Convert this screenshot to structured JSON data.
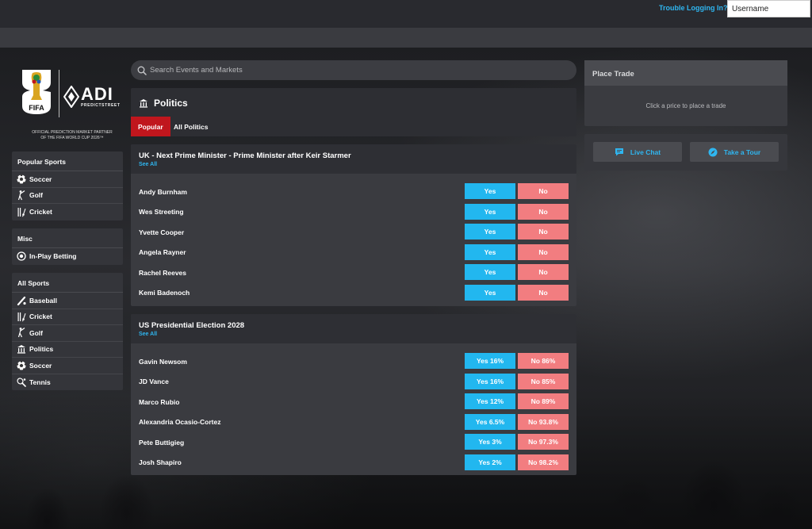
{
  "colors": {
    "accent": "#2fb6f0",
    "yes": "#22b7ef",
    "no": "#f27d80",
    "tab_active": "#c0161d"
  },
  "header": {
    "trouble_link": "Trouble Logging In?",
    "username_value": "Username"
  },
  "logo": {
    "fifa_text": "FIFA",
    "adi_text": "ADI",
    "adi_sub": "PREDICTSTREET",
    "partner_line1": "OFFICIAL PREDICTION MARKET PARTNER",
    "partner_line2": "OF THE FIFA WORLD CUP 2026™"
  },
  "sidebar": {
    "popular": {
      "title": "Popular Sports",
      "items": [
        {
          "label": "Soccer",
          "icon": "soccer-ball-icon"
        },
        {
          "label": "Golf",
          "icon": "golfer-icon"
        },
        {
          "label": "Cricket",
          "icon": "cricket-icon"
        }
      ]
    },
    "misc": {
      "title": "Misc",
      "items": [
        {
          "label": "In-Play Betting",
          "icon": "inplay-icon"
        }
      ]
    },
    "all": {
      "title": "All Sports",
      "items": [
        {
          "label": "Baseball",
          "icon": "baseball-icon"
        },
        {
          "label": "Cricket",
          "icon": "cricket-icon"
        },
        {
          "label": "Golf",
          "icon": "golfer-icon"
        },
        {
          "label": "Politics",
          "icon": "capitol-icon"
        },
        {
          "label": "Soccer",
          "icon": "soccer-ball-icon"
        },
        {
          "label": "Tennis",
          "icon": "tennis-icon"
        }
      ]
    }
  },
  "search": {
    "placeholder": "Search Events and Markets"
  },
  "politics": {
    "title": "Politics",
    "tabs": [
      {
        "label": "Popular"
      },
      {
        "label": "All Politics"
      }
    ]
  },
  "markets": [
    {
      "title": "UK - Next Prime Minister - Prime Minister after Keir Starmer",
      "see_all": "See All",
      "rows": [
        {
          "name": "Andy Burnham",
          "yes": "Yes",
          "no": "No"
        },
        {
          "name": "Wes Streeting",
          "yes": "Yes",
          "no": "No"
        },
        {
          "name": "Yvette Cooper",
          "yes": "Yes",
          "no": "No"
        },
        {
          "name": "Angela Rayner",
          "yes": "Yes",
          "no": "No"
        },
        {
          "name": "Rachel Reeves",
          "yes": "Yes",
          "no": "No"
        },
        {
          "name": "Kemi Badenoch",
          "yes": "Yes",
          "no": "No"
        }
      ]
    },
    {
      "title": "US Presidential Election 2028",
      "see_all": "See All",
      "rows": [
        {
          "name": "Gavin Newsom",
          "yes": "Yes 16%",
          "no": "No 86%"
        },
        {
          "name": "JD Vance",
          "yes": "Yes 16%",
          "no": "No 85%"
        },
        {
          "name": "Marco Rubio",
          "yes": "Yes 12%",
          "no": "No 89%"
        },
        {
          "name": "Alexandria Ocasio-Cortez",
          "yes": "Yes 6.5%",
          "no": "No 93.8%"
        },
        {
          "name": "Pete Buttigieg",
          "yes": "Yes 3%",
          "no": "No 97.3%"
        },
        {
          "name": "Josh Shapiro",
          "yes": "Yes 2%",
          "no": "No 98.2%"
        }
      ]
    }
  ],
  "trade": {
    "title": "Place Trade",
    "message": "Click a price to place a trade"
  },
  "help": {
    "live_chat": "Live Chat",
    "tour": "Take a Tour"
  }
}
